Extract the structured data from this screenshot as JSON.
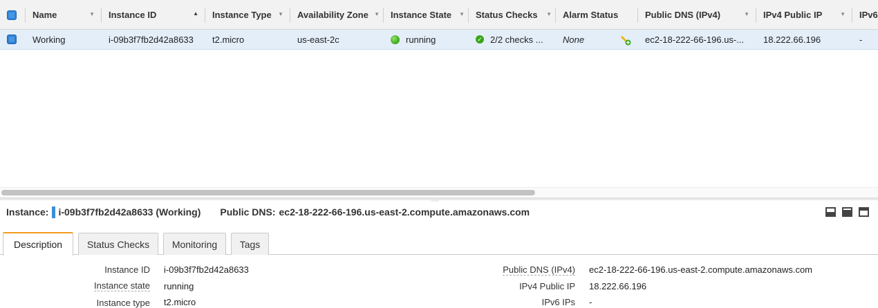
{
  "columns": [
    {
      "label": "Name"
    },
    {
      "label": "Instance ID"
    },
    {
      "label": "Instance Type"
    },
    {
      "label": "Availability Zone"
    },
    {
      "label": "Instance State"
    },
    {
      "label": "Status Checks"
    },
    {
      "label": "Alarm Status"
    },
    {
      "label": "Public DNS (IPv4)"
    },
    {
      "label": "IPv4 Public IP"
    },
    {
      "label": "IPv6"
    }
  ],
  "row": {
    "name": "Working",
    "instance_id": "i-09b3f7fb2d42a8633",
    "instance_type": "t2.micro",
    "availability_zone": "us-east-2c",
    "instance_state": "running",
    "status_checks": "2/2 checks ...",
    "alarm_status": "None",
    "public_dns": "ec2-18-222-66-196.us-...",
    "ipv4_public_ip": "18.222.66.196",
    "ipv6": "-"
  },
  "instance_bar": {
    "label": "Instance:",
    "value": "i-09b3f7fb2d42a8633 (Working)",
    "dns_label": "Public DNS:",
    "dns_value": "ec2-18-222-66-196.us-east-2.compute.amazonaws.com"
  },
  "tabs": [
    {
      "label": "Description"
    },
    {
      "label": "Status Checks"
    },
    {
      "label": "Monitoring"
    },
    {
      "label": "Tags"
    }
  ],
  "description": {
    "left": [
      {
        "label": "Instance ID",
        "value": "i-09b3f7fb2d42a8633"
      },
      {
        "label": "Instance state",
        "value": "running"
      },
      {
        "label": "Instance type",
        "value": "t2.micro"
      }
    ],
    "right": [
      {
        "label": "Public DNS (IPv4)",
        "value": "ec2-18-222-66-196.us-east-2.compute.amazonaws.com"
      },
      {
        "label": "IPv4 Public IP",
        "value": "18.222.66.196"
      },
      {
        "label": "IPv6 IPs",
        "value": "-"
      }
    ]
  },
  "icons": {
    "running": "status-running-icon",
    "checks": "check-passed-icon",
    "alarm": "create-alarm-icon"
  },
  "colors": {
    "selected_row": "#e4eef9",
    "active_tab_accent": "#f29b1d",
    "running_green": "#3aa51b",
    "checkbox_blue": "#2a7fd4"
  }
}
